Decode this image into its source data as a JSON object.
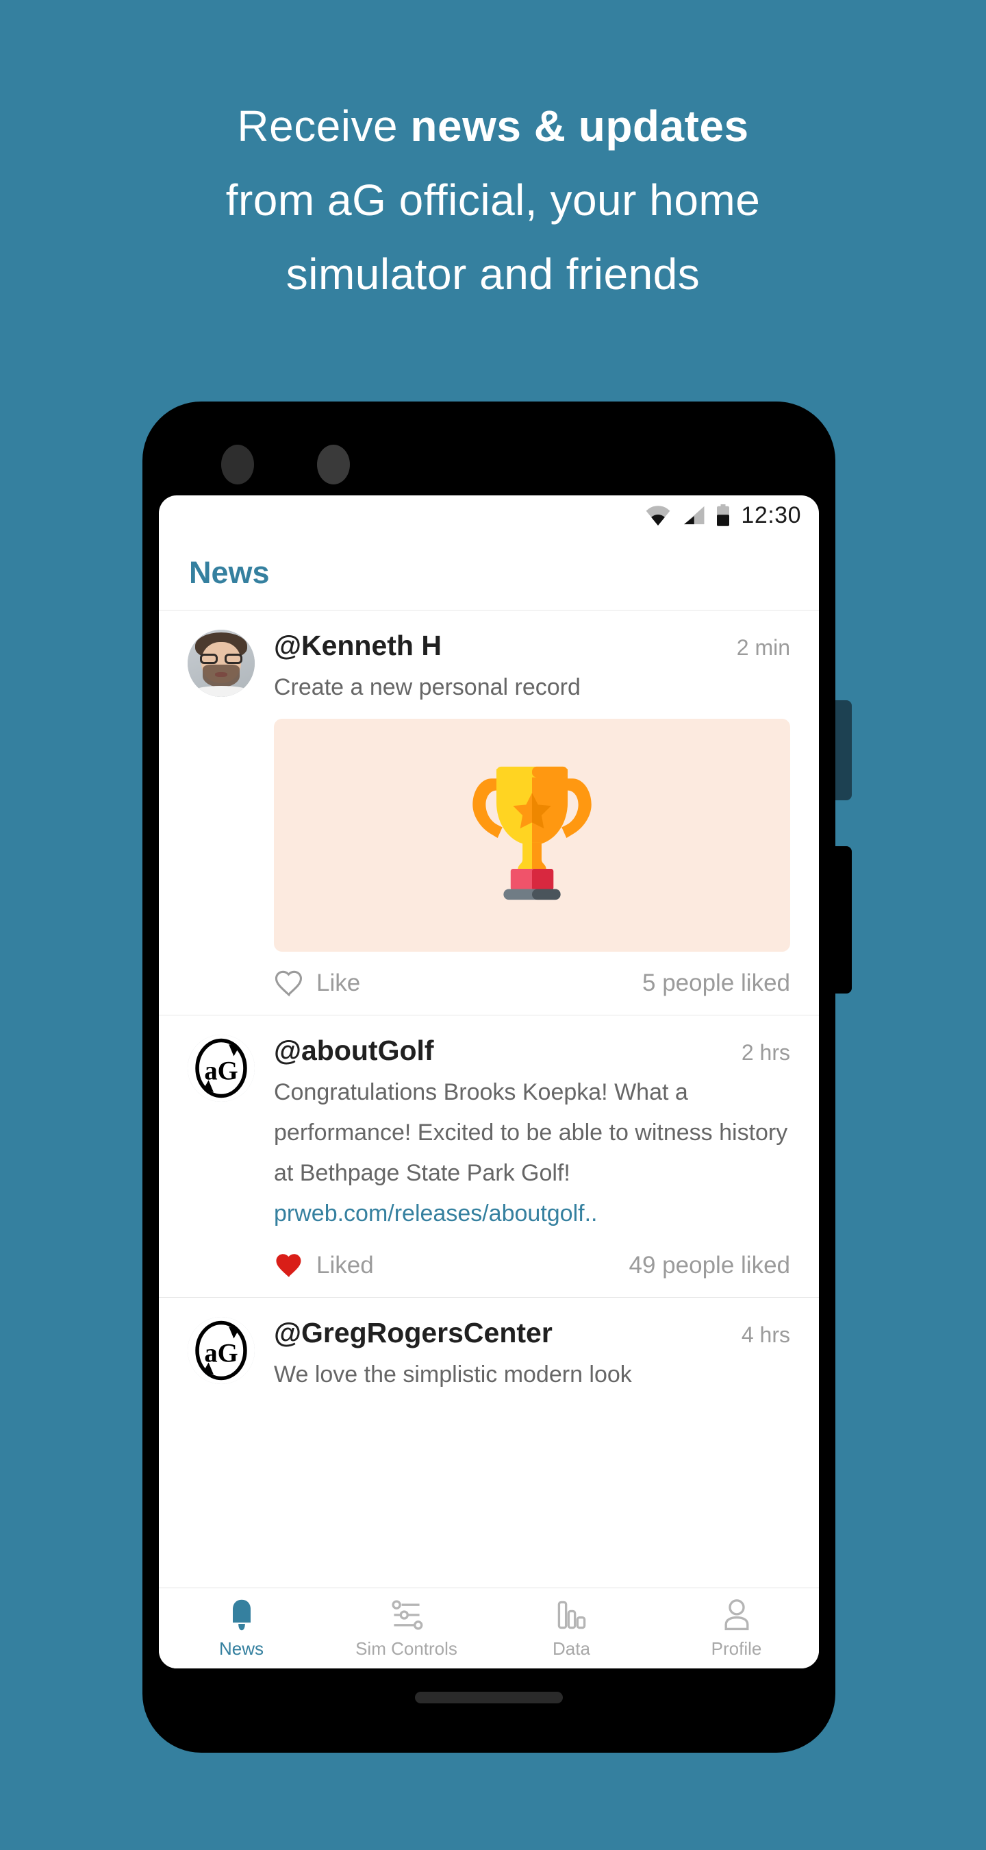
{
  "promo": {
    "line1_plain": "Receive ",
    "line1_bold": "news & updates",
    "line2": "from aG official, your home",
    "line3": "simulator and friends",
    "background_color": "#35809F"
  },
  "device": {
    "status_bar": {
      "time": "12:30",
      "icons": [
        "wifi-icon",
        "cellular-signal-icon",
        "battery-icon"
      ]
    },
    "home_indicator": "home-indicator",
    "camera_dots": 2,
    "side_buttons": [
      "power-button",
      "volume-rocker"
    ]
  },
  "app": {
    "header": {
      "title": "News",
      "title_color": "#35809F"
    },
    "posts": [
      {
        "avatar": "user-photo-avatar",
        "handle": "@Kenneth H",
        "timestamp": "2 min",
        "text": "Create a new personal record",
        "media": {
          "type": "trophy-image",
          "background_color": "#FCEADF"
        },
        "like_label": "Like",
        "liked": false,
        "like_count_label": "5 people liked"
      },
      {
        "avatar": "ag-logo-avatar",
        "handle": "@aboutGolf",
        "timestamp": "2 hrs",
        "text": "Congratulations Brooks Koepka! What a performance! Excited to be able to witness history at Bethpage State Park Golf!",
        "link": "prweb.com/releases/aboutgolf..",
        "like_label": "Liked",
        "liked": true,
        "like_count_label": "49 people liked"
      },
      {
        "avatar": "ag-logo-avatar",
        "handle": "@GregRogersCenter",
        "timestamp": "4 hrs",
        "text": "We love the simplistic modern look"
      }
    ],
    "bottom_nav": {
      "active": "News",
      "items": [
        {
          "label": "News",
          "icon": "bell-icon"
        },
        {
          "label": "Sim Controls",
          "icon": "sliders-icon"
        },
        {
          "label": "Data",
          "icon": "bar-chart-icon"
        },
        {
          "label": "Profile",
          "icon": "person-icon"
        }
      ]
    }
  },
  "colors": {
    "accent": "#35809F",
    "liked_heart": "#D91E18",
    "muted_text": "#9b9b9b"
  }
}
